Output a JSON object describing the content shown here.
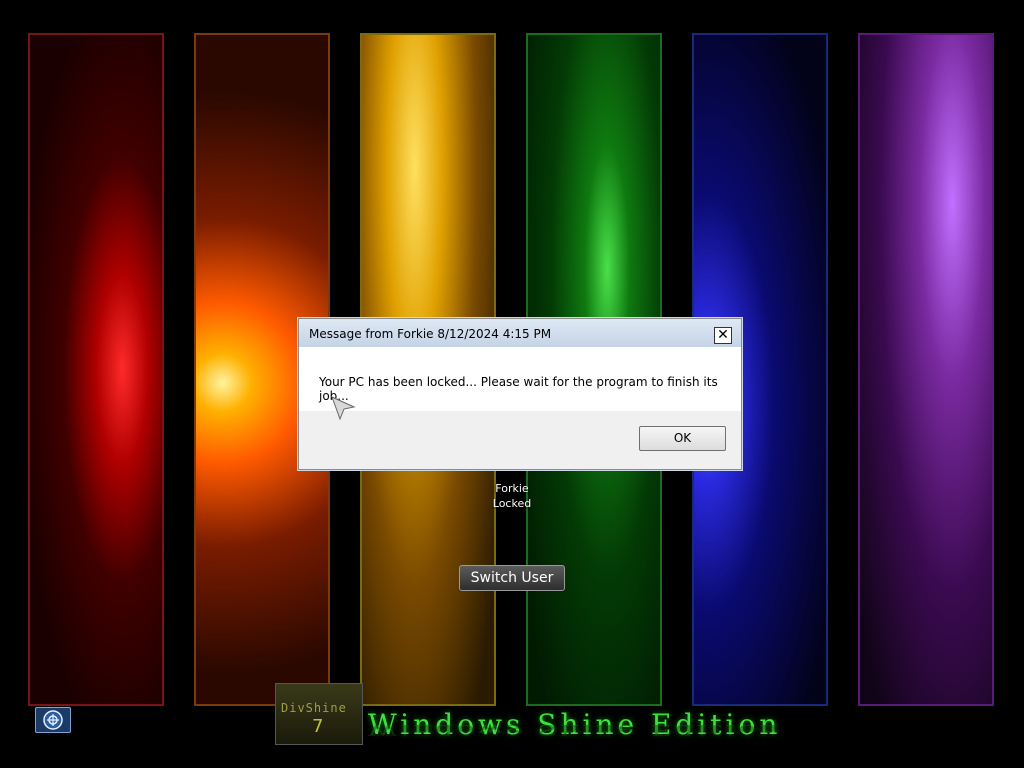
{
  "dialog": {
    "title": "Message from Forkie 8/12/2024 4:15 PM",
    "close_label": "✕",
    "message": "Your PC has been locked... Please wait for the program to finish its job...",
    "ok_label": "OK"
  },
  "user": {
    "name": "Forkie",
    "status": "Locked"
  },
  "switch_user_label": "Switch User",
  "branding": {
    "logo_text": "DivShine",
    "logo_version": "7",
    "edition_text": "Windows Shine Edition"
  },
  "icons": {
    "ease_of_access": "ease-of-access-icon",
    "cursor": "mouse-cursor-icon"
  },
  "colors": {
    "brand_green": "#3ee03e",
    "dialog_title": "#dfe9f5"
  }
}
